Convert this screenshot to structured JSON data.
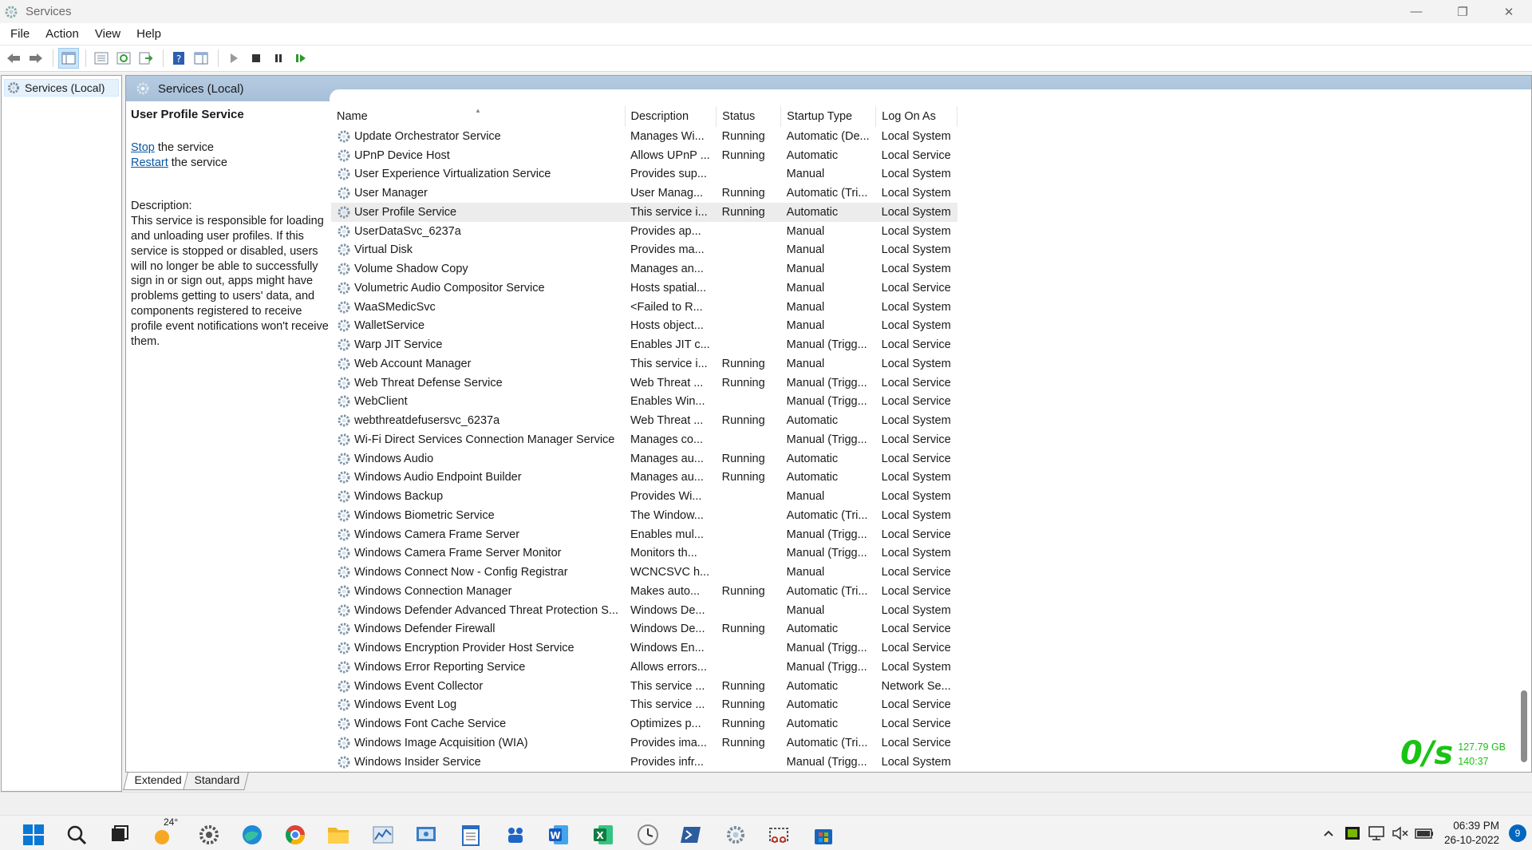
{
  "window": {
    "title": "Services",
    "minimize": "—",
    "restore": "❐",
    "close": "✕"
  },
  "menu": [
    "File",
    "Action",
    "View",
    "Help"
  ],
  "tree": {
    "root_label": "Services (Local)"
  },
  "content_header": {
    "title": "Services (Local)"
  },
  "details": {
    "service_name": "User Profile Service",
    "stop_link": "Stop",
    "stop_suffix": " the service",
    "restart_link": "Restart",
    "restart_suffix": " the service",
    "description_label": "Description:",
    "description_text": "This service is responsible for loading and unloading user profiles. If this service is stopped or disabled, users will no longer be able to successfully sign in or sign out, apps might have problems getting to users' data, and components registered to receive profile event notifications won't receive them."
  },
  "columns": {
    "name": "Name",
    "description": "Description",
    "status": "Status",
    "startup_type": "Startup Type",
    "log_on_as": "Log On As"
  },
  "services": [
    [
      "Update Orchestrator Service",
      "Manages Wi...",
      "Running",
      "Automatic (De...",
      "Local System"
    ],
    [
      "UPnP Device Host",
      "Allows UPnP ...",
      "Running",
      "Automatic",
      "Local Service"
    ],
    [
      "User Experience Virtualization Service",
      "Provides sup...",
      "",
      "Manual",
      "Local System"
    ],
    [
      "User Manager",
      "User Manag...",
      "Running",
      "Automatic (Tri...",
      "Local System"
    ],
    [
      "User Profile Service",
      "This service i...",
      "Running",
      "Automatic",
      "Local System"
    ],
    [
      "UserDataSvc_6237a",
      "Provides ap...",
      "",
      "Manual",
      "Local System"
    ],
    [
      "Virtual Disk",
      "Provides ma...",
      "",
      "Manual",
      "Local System"
    ],
    [
      "Volume Shadow Copy",
      "Manages an...",
      "",
      "Manual",
      "Local System"
    ],
    [
      "Volumetric Audio Compositor Service",
      "Hosts spatial...",
      "",
      "Manual",
      "Local Service"
    ],
    [
      "WaaSMedicSvc",
      "<Failed to R...",
      "",
      "Manual",
      "Local System"
    ],
    [
      "WalletService",
      "Hosts object...",
      "",
      "Manual",
      "Local System"
    ],
    [
      "Warp JIT Service",
      "Enables JIT c...",
      "",
      "Manual (Trigg...",
      "Local Service"
    ],
    [
      "Web Account Manager",
      "This service i...",
      "Running",
      "Manual",
      "Local System"
    ],
    [
      "Web Threat Defense Service",
      "Web Threat ...",
      "Running",
      "Manual (Trigg...",
      "Local Service"
    ],
    [
      "WebClient",
      "Enables Win...",
      "",
      "Manual (Trigg...",
      "Local Service"
    ],
    [
      "webthreatdefusersvc_6237a",
      "Web Threat ...",
      "Running",
      "Automatic",
      "Local System"
    ],
    [
      "Wi-Fi Direct Services Connection Manager Service",
      "Manages co...",
      "",
      "Manual (Trigg...",
      "Local Service"
    ],
    [
      "Windows Audio",
      "Manages au...",
      "Running",
      "Automatic",
      "Local Service"
    ],
    [
      "Windows Audio Endpoint Builder",
      "Manages au...",
      "Running",
      "Automatic",
      "Local System"
    ],
    [
      "Windows Backup",
      "Provides Wi...",
      "",
      "Manual",
      "Local System"
    ],
    [
      "Windows Biometric Service",
      "The Window...",
      "",
      "Automatic (Tri...",
      "Local System"
    ],
    [
      "Windows Camera Frame Server",
      "Enables mul...",
      "",
      "Manual (Trigg...",
      "Local Service"
    ],
    [
      "Windows Camera Frame Server Monitor",
      "Monitors th...",
      "",
      "Manual (Trigg...",
      "Local System"
    ],
    [
      "Windows Connect Now - Config Registrar",
      "WCNCSVC h...",
      "",
      "Manual",
      "Local Service"
    ],
    [
      "Windows Connection Manager",
      "Makes auto...",
      "Running",
      "Automatic (Tri...",
      "Local Service"
    ],
    [
      "Windows Defender Advanced Threat Protection S...",
      "Windows De...",
      "",
      "Manual",
      "Local System"
    ],
    [
      "Windows Defender Firewall",
      "Windows De...",
      "Running",
      "Automatic",
      "Local Service"
    ],
    [
      "Windows Encryption Provider Host Service",
      "Windows En...",
      "",
      "Manual (Trigg...",
      "Local Service"
    ],
    [
      "Windows Error Reporting Service",
      "Allows errors...",
      "",
      "Manual (Trigg...",
      "Local System"
    ],
    [
      "Windows Event Collector",
      "This service ...",
      "Running",
      "Automatic",
      "Network Se..."
    ],
    [
      "Windows Event Log",
      "This service ...",
      "Running",
      "Automatic",
      "Local Service"
    ],
    [
      "Windows Font Cache Service",
      "Optimizes p...",
      "Running",
      "Automatic",
      "Local Service"
    ],
    [
      "Windows Image Acquisition (WIA)",
      "Provides ima...",
      "Running",
      "Automatic (Tri...",
      "Local Service"
    ],
    [
      "Windows Insider Service",
      "Provides infr...",
      "",
      "Manual (Trigg...",
      "Local System"
    ]
  ],
  "selected_service": "User Profile Service",
  "tabs": [
    "Extended",
    "Standard"
  ],
  "speed_widget": {
    "rate": "0/s",
    "storage": "127.79 GB",
    "time": "140:37"
  },
  "taskbar": {
    "weather_temp": "24°",
    "clock_time": "06:39 PM",
    "clock_date": "26-10-2022",
    "notification_count": "9"
  },
  "colors": {
    "header_gradient": "#b0c7df",
    "link": "#0b57a4",
    "speed_green": "#19c313",
    "accent": "#005fb8"
  }
}
